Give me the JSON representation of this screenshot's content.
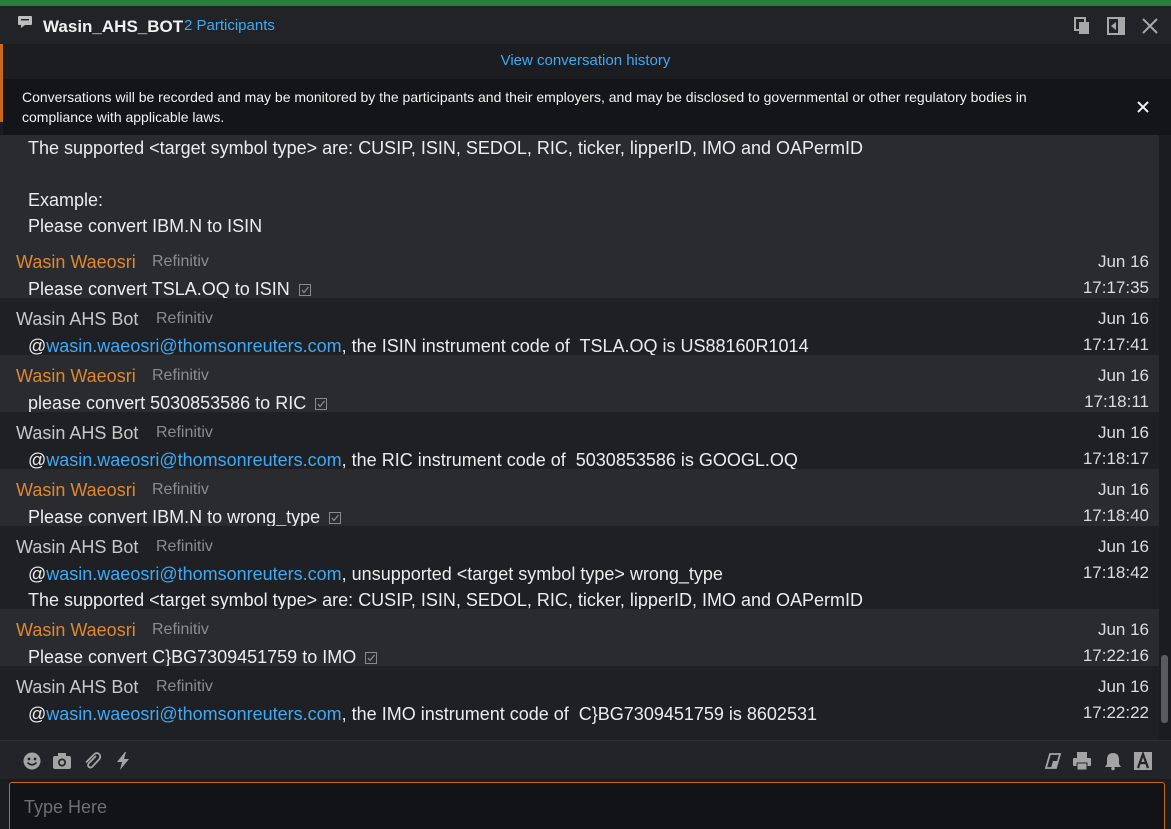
{
  "header": {
    "title": "Wasin_AHS_BOT",
    "participants": "2 Participants"
  },
  "history_link": "View conversation history",
  "notice": {
    "text": "Conversations will be recorded and may be monitored by the participants and their employers, and may be disclosed to governmental or other regulatory bodies in compliance with applicable laws."
  },
  "top_continuation": {
    "line1": "The supported <target symbol type> are: CUSIP, ISIN, SEDOL, RIC, ticker, lipperID, IMO and OAPermID",
    "line2": "Example:",
    "line3": "Please convert IBM.N to ISIN"
  },
  "messages": [
    {
      "sender": "Wasin Waeosri",
      "org": "Refinitiv",
      "date": "Jun 16",
      "time": "17:17:35",
      "text": "Please convert TSLA.OQ to ISIN"
    },
    {
      "sender": "Wasin AHS Bot",
      "org": "Refinitiv",
      "date": "Jun 16",
      "time": "17:17:41",
      "mention": "wasin.waeosri@thomsonreuters.com",
      "text": ", the ISIN instrument code of  TSLA.OQ is US88160R1014"
    },
    {
      "sender": "Wasin Waeosri",
      "org": "Refinitiv",
      "date": "Jun 16",
      "time": "17:18:11",
      "text": "please convert 5030853586 to RIC"
    },
    {
      "sender": "Wasin AHS Bot",
      "org": "Refinitiv",
      "date": "Jun 16",
      "time": "17:18:17",
      "mention": "wasin.waeosri@thomsonreuters.com",
      "text": ", the RIC instrument code of  5030853586 is GOOGL.OQ"
    },
    {
      "sender": "Wasin Waeosri",
      "org": "Refinitiv",
      "date": "Jun 16",
      "time": "17:18:40",
      "text": "Please convert IBM.N to wrong_type"
    },
    {
      "sender": "Wasin AHS Bot",
      "org": "Refinitiv",
      "date": "Jun 16",
      "time": "17:18:42",
      "mention": "wasin.waeosri@thomsonreuters.com",
      "text": ", unsupported <target symbol type> wrong_type",
      "text2": "The supported <target symbol type> are: CUSIP, ISIN, SEDOL, RIC, ticker, lipperID, IMO and OAPermID"
    },
    {
      "sender": "Wasin Waeosri",
      "org": "Refinitiv",
      "date": "Jun 16",
      "time": "17:22:16",
      "text": "Please convert C}BG7309451759 to IMO"
    },
    {
      "sender": "Wasin AHS Bot",
      "org": "Refinitiv",
      "date": "Jun 16",
      "time": "17:22:22",
      "mention": "wasin.waeosri@thomsonreuters.com",
      "text": ", the IMO instrument code of  C}BG7309451759 is 8602531"
    }
  ],
  "at_sign": "@",
  "input": {
    "placeholder": "Type Here"
  },
  "icons": {
    "toolbar_left": [
      "emoji-icon",
      "camera-icon",
      "attachment-icon",
      "lightning-icon"
    ],
    "toolbar_right": [
      "eraser-icon",
      "print-icon",
      "bell-icon",
      "font-icon"
    ]
  },
  "colors": {
    "accent": "#c96a16",
    "link": "#3fa9f5",
    "user_name": "#e0872f"
  }
}
